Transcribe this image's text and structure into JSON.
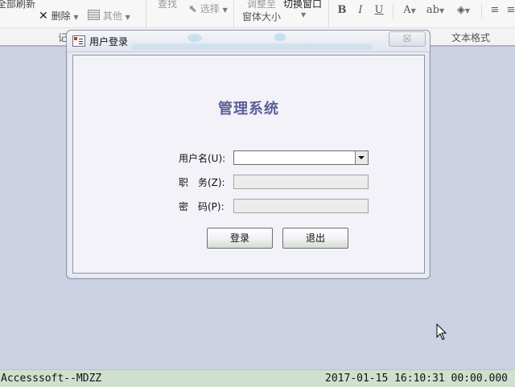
{
  "ribbon": {
    "refresh_all": "全部刷新",
    "delete": "删除",
    "other": "其他",
    "find": "查找",
    "select": "选择",
    "adjust_line1": "调整至",
    "adjust_line2": "窗体大小",
    "switch_window": "切换窗口",
    "bold": "B",
    "italic": "I",
    "underline": "U",
    "records_group": "记",
    "text_format_group": "文本格式"
  },
  "dialog": {
    "title": "用户登录",
    "close_symbol": "☒",
    "system_title": "管理系统",
    "username_label": "用户名(U):",
    "position_label": "职　务(Z):",
    "password_label": "密　码(P):",
    "username_value": "",
    "position_value": "",
    "password_value": "",
    "login_button": "登录",
    "exit_button": "退出"
  },
  "statusbar": {
    "left": "Accesssoft--MDZZ",
    "right": "2017-01-15 16:10:31 00:00.000"
  },
  "colors": {
    "desktop": "#ccd1e4",
    "title_text": "#5b5f98",
    "status_bg": "#cfe0cf"
  },
  "icons": [
    "form-icon",
    "delete-icon",
    "other-icon",
    "select-icon",
    "font-color-icon",
    "highlight-icon",
    "fill-color-icon",
    "align-icon",
    "mouse-cursor-icon"
  ]
}
